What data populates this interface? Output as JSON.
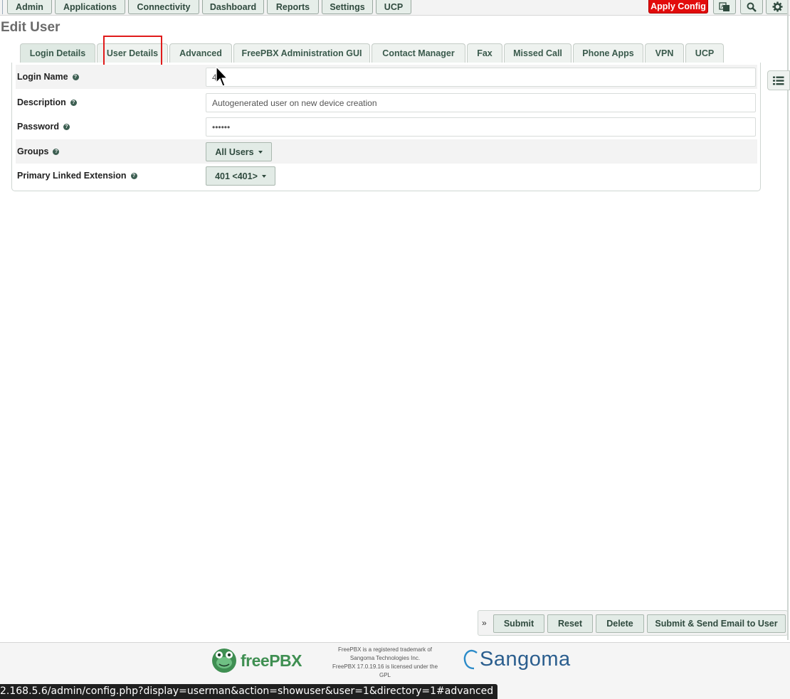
{
  "nav": {
    "items": [
      "Admin",
      "Applications",
      "Connectivity",
      "Dashboard",
      "Reports",
      "Settings",
      "UCP"
    ],
    "apply_config": "Apply Config",
    "icons": [
      "language-icon",
      "search-icon",
      "gear-icon"
    ]
  },
  "page": {
    "title": "Edit User"
  },
  "tabs": [
    {
      "label": "Login Details",
      "active": true
    },
    {
      "label": "User Details"
    },
    {
      "label": "Advanced"
    },
    {
      "label": "FreePBX Administration GUI"
    },
    {
      "label": "Contact Manager"
    },
    {
      "label": "Fax"
    },
    {
      "label": "Missed Call"
    },
    {
      "label": "Phone Apps"
    },
    {
      "label": "VPN"
    },
    {
      "label": "UCP"
    }
  ],
  "form": {
    "login_name": {
      "label": "Login Name",
      "value": "4"
    },
    "description": {
      "label": "Description",
      "value": "Autogenerated user on new device creation"
    },
    "password": {
      "label": "Password",
      "value": "••••••"
    },
    "groups": {
      "label": "Groups",
      "value": "All Users"
    },
    "primary_ext": {
      "label": "Primary Linked Extension",
      "value": "401 <401>"
    }
  },
  "actions": {
    "submit": "Submit",
    "reset": "Reset",
    "delete": "Delete",
    "submit_email": "Submit & Send Email to User"
  },
  "footer": {
    "freepbx_logo": "freePBX",
    "trademark_lines": [
      "FreePBX is a registered trademark of",
      "Sangoma Technologies Inc.",
      "FreePBX 17.0.19.16 is licensed under the",
      "GPL"
    ],
    "sangoma_logo": "Sangoma"
  },
  "status_bar": {
    "url": "2.168.5.6/admin/config.php?display=userman&action=showuser&user=1&directory=1#advanced"
  },
  "colors": {
    "accent": "#3a5a4c",
    "apply": "#e20c0c",
    "highlight": "#e01b1b"
  }
}
